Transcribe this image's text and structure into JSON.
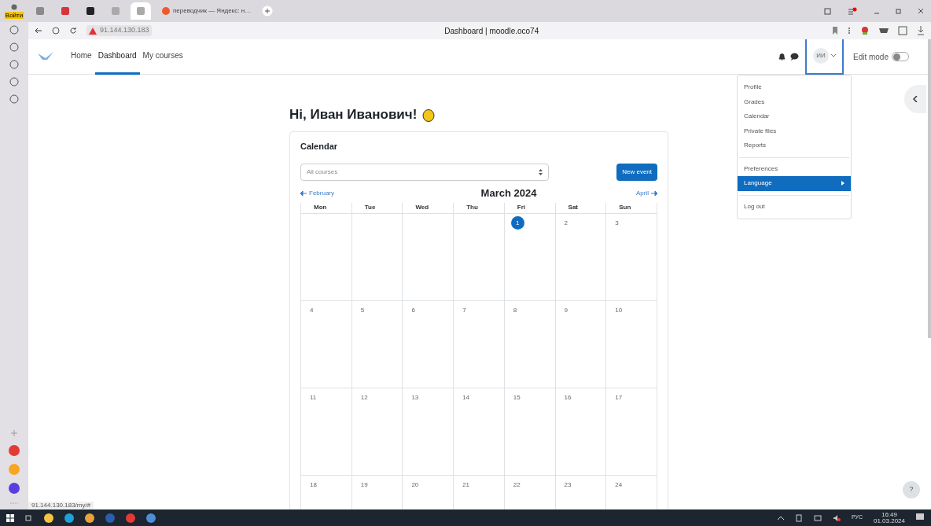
{
  "browser": {
    "profile_label": "Войти",
    "tabs": [
      {
        "kind": "icon",
        "selected": false
      },
      {
        "kind": "icon",
        "selected": false
      },
      {
        "kind": "icon",
        "selected": false
      },
      {
        "kind": "icon",
        "selected": false
      },
      {
        "kind": "icon",
        "selected": true
      },
      {
        "kind": "text",
        "label": "переводчик — Яндекс: н…",
        "selected": false
      }
    ],
    "address": "91.144.130.183",
    "page_title": "Dashboard | moodle.oco74",
    "status_url": "91.144.130.183/my/#"
  },
  "nav": {
    "links": [
      {
        "label": "Home",
        "selected": false
      },
      {
        "label": "Dashboard",
        "selected": true
      },
      {
        "label": "My courses",
        "selected": false
      }
    ],
    "user_initials": "ИИ",
    "edit_mode": {
      "label": "Edit mode",
      "on": false
    }
  },
  "user_menu": {
    "groups": [
      [
        {
          "label": "Profile",
          "selected": false
        },
        {
          "label": "Grades",
          "selected": false
        },
        {
          "label": "Calendar",
          "selected": false
        },
        {
          "label": "Private files",
          "selected": false
        },
        {
          "label": "Reports",
          "selected": false
        }
      ],
      [
        {
          "label": "Preferences",
          "selected": false
        },
        {
          "label": "Language",
          "selected": true
        }
      ],
      [
        {
          "label": "Log out",
          "selected": false
        }
      ]
    ]
  },
  "greeting": "Hi, Иван Иванович!",
  "calendar": {
    "title": "Calendar",
    "course_filter": "All courses",
    "new_event": "New event",
    "prev": "February",
    "month": "March 2024",
    "next": "April",
    "weekdays": [
      "Mon",
      "Tue",
      "Wed",
      "Thu",
      "Fri",
      "Sat",
      "Sun"
    ],
    "weeks": [
      [
        {
          "kind": "blank"
        },
        {
          "kind": "blank"
        },
        {
          "kind": "blank"
        },
        {
          "kind": "blank"
        },
        {
          "kind": "day",
          "day": "1",
          "today": true
        },
        {
          "kind": "day",
          "day": "2",
          "today": false
        },
        {
          "kind": "day",
          "day": "3",
          "today": false
        }
      ],
      [
        {
          "kind": "day",
          "day": "4",
          "today": false
        },
        {
          "kind": "day",
          "day": "5",
          "today": false
        },
        {
          "kind": "day",
          "day": "6",
          "today": false
        },
        {
          "kind": "day",
          "day": "7",
          "today": false
        },
        {
          "kind": "day",
          "day": "8",
          "today": false
        },
        {
          "kind": "day",
          "day": "9",
          "today": false
        },
        {
          "kind": "day",
          "day": "10",
          "today": false
        }
      ],
      [
        {
          "kind": "day",
          "day": "11",
          "today": false
        },
        {
          "kind": "day",
          "day": "12",
          "today": false
        },
        {
          "kind": "day",
          "day": "13",
          "today": false
        },
        {
          "kind": "day",
          "day": "14",
          "today": false
        },
        {
          "kind": "day",
          "day": "15",
          "today": false
        },
        {
          "kind": "day",
          "day": "16",
          "today": false
        },
        {
          "kind": "day",
          "day": "17",
          "today": false
        }
      ],
      [
        {
          "kind": "day",
          "day": "18",
          "today": false
        },
        {
          "kind": "day",
          "day": "19",
          "today": false
        },
        {
          "kind": "day",
          "day": "20",
          "today": false
        },
        {
          "kind": "day",
          "day": "21",
          "today": false
        },
        {
          "kind": "day",
          "day": "22",
          "today": false
        },
        {
          "kind": "day",
          "day": "23",
          "today": false
        },
        {
          "kind": "day",
          "day": "24",
          "today": false
        }
      ]
    ]
  },
  "help": "?",
  "taskbar": {
    "language": "РУС",
    "time": "16:49",
    "date": "01.03.2024"
  }
}
